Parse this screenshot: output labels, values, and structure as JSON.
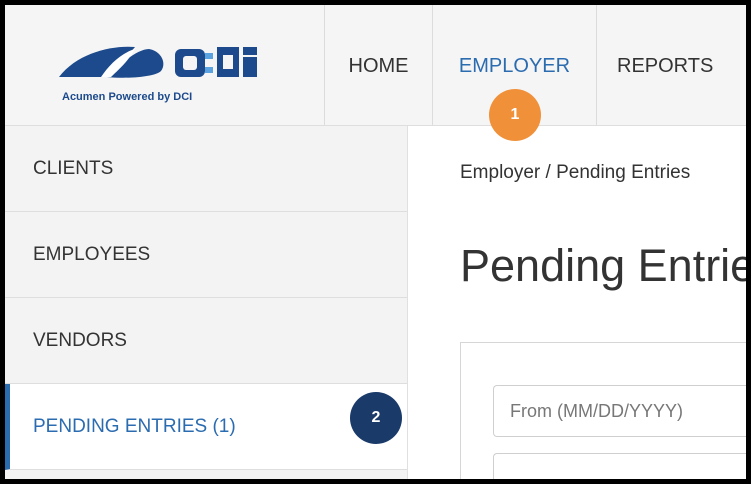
{
  "logo": {
    "tagline": "Acumen Powered by DCI",
    "colors": {
      "dark_blue": "#1c4a8c",
      "light_blue": "#5aa3e0"
    }
  },
  "nav": {
    "items": [
      {
        "label": "HOME"
      },
      {
        "label": "EMPLOYER",
        "active": true
      },
      {
        "label": "REPORTS"
      }
    ]
  },
  "callouts": {
    "step1": "1",
    "step2": "2",
    "colors": {
      "step1": "#f0913a",
      "step2": "#1a3a6a"
    }
  },
  "sidebar": {
    "items": [
      {
        "label": "CLIENTS"
      },
      {
        "label": "EMPLOYEES"
      },
      {
        "label": "VENDORS"
      },
      {
        "label": "PENDING ENTRIES (1)",
        "active": true
      }
    ]
  },
  "main": {
    "breadcrumb": "Employer / Pending Entries",
    "title": "Pending Entries",
    "from_placeholder": "From (MM/DD/YYYY)"
  },
  "theme": {
    "accent": "#2b6cb0",
    "text": "#333333"
  }
}
